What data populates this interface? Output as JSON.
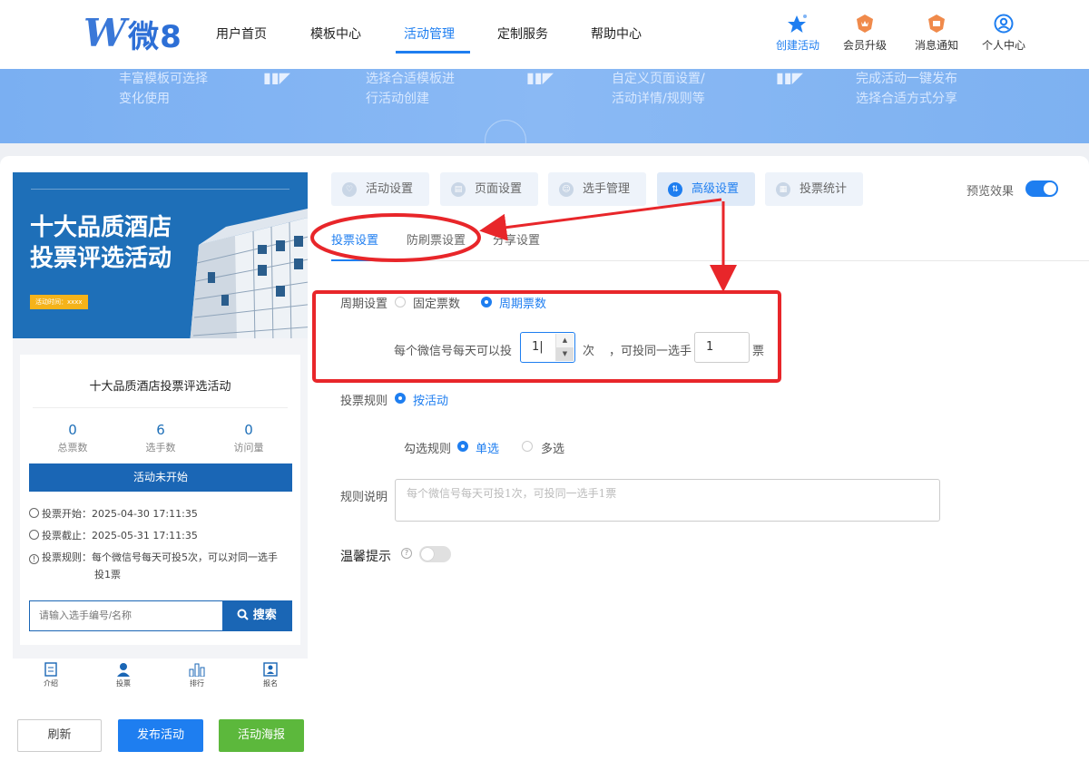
{
  "header": {
    "logo_text": "微8",
    "nav": [
      "用户首页",
      "模板中心",
      "活动管理",
      "定制服务",
      "帮助中心"
    ],
    "tools": [
      "创建活动",
      "会员升级",
      "消息通知",
      "个人中心"
    ]
  },
  "banner": {
    "steps": [
      [
        "丰富模板可选择",
        "变化使用"
      ],
      [
        "选择合适模板进",
        "行活动创建"
      ],
      [
        "自定义页面设置/",
        "活动详情/规则等"
      ],
      [
        "完成活动一键发布",
        "选择合适方式分享"
      ]
    ]
  },
  "preview": {
    "poster_title_1": "十大品质酒店",
    "poster_title_2": "投票评选活动",
    "poster_tag": "活动时间：xxxx",
    "card_title": "十大品质酒店投票评选活动",
    "stats": [
      {
        "value": "0",
        "label": "总票数"
      },
      {
        "value": "6",
        "label": "选手数"
      },
      {
        "value": "0",
        "label": "访问量"
      }
    ],
    "status_button": "活动未开始",
    "vote_start": "投票开始：2025-04-30 17:11:35",
    "vote_end": "投票截止：2025-05-31 17:11:35",
    "vote_rule_1": "投票规则：每个微信号每天可投5次，可以对同一选手",
    "vote_rule_2": "投1票",
    "search_placeholder": "请输入选手编号/名称",
    "search_button": "搜索",
    "bottom_tabs": [
      "介绍",
      "投票",
      "排行",
      "报名"
    ]
  },
  "actions": {
    "refresh": "刷新",
    "publish": "发布活动",
    "poster": "活动海报"
  },
  "settings": {
    "tabs": [
      "活动设置",
      "页面设置",
      "选手管理",
      "高级设置",
      "投票统计"
    ],
    "active_tab": "高级设置",
    "preview_label": "预览效果",
    "preview_on": true,
    "subtabs": [
      "投票设置",
      "防刷票设置",
      "分享设置"
    ],
    "period_label": "周期设置",
    "period_options": [
      "固定票数",
      "周期票数"
    ],
    "period_selected": "周期票数",
    "daily_prefix": "每个微信号每天可以投",
    "daily_value": "1|",
    "daily_unit": "次",
    "same_prefix": "，可投同一选手",
    "same_value": "1",
    "same_unit": "票",
    "rule_label": "投票规则",
    "rule_option": "按活动",
    "select_label": "勾选规则",
    "select_options": [
      "单选",
      "多选"
    ],
    "select_selected": "单选",
    "desc_label": "规则说明",
    "desc_placeholder": "每个微信号每天可投1次，可投同一选手1票",
    "tip_label": "温馨提示",
    "tip_on": false
  },
  "colors": {
    "accent": "#1e7ef0",
    "preview_blue": "#1a66b5",
    "poster_green": "#5cb83c",
    "annotation_red": "#e8262a"
  }
}
